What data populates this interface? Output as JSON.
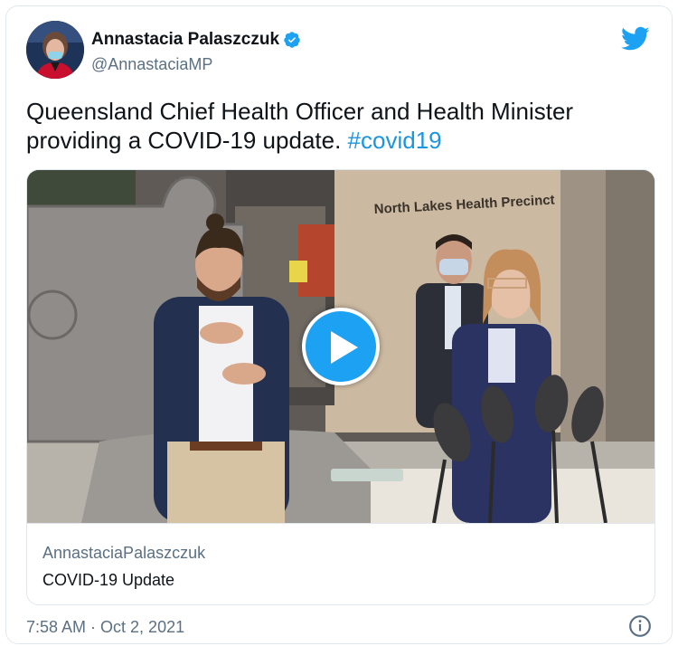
{
  "author": {
    "display_name": "Annastacia Palaszczuk",
    "handle": "@AnnastaciaMP",
    "verified_icon": "verified-badge-icon",
    "avatar": "author-avatar"
  },
  "brand_icon": "twitter-bird-icon",
  "tweet": {
    "text_main": "Queensland Chief Health Officer and Health Minister providing a COVID-19 update. ",
    "hashtag": "#covid19"
  },
  "media": {
    "type": "video",
    "sign_text": "North Lakes Health Precinct",
    "play_icon": "play-icon",
    "card_source": "AnnastaciaPalaszczuk",
    "card_title": "COVID-19 Update"
  },
  "meta": {
    "timestamp": "7:58 AM · Oct 2, 2021",
    "info_icon": "info-icon"
  },
  "colors": {
    "accent": "#1da1f2",
    "hashtag": "#1b95e0",
    "secondary_text": "#5b7083",
    "border": "#e1e8ed"
  }
}
